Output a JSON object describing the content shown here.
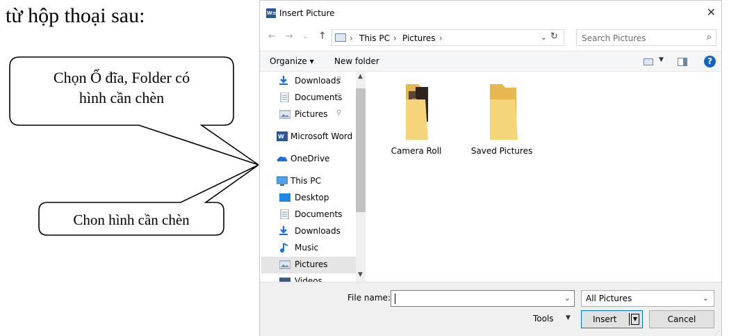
{
  "document": {
    "heading": "từ hộp thoại sau:",
    "callouts": [
      {
        "line1": "Chọn Ổ đĩa, Folder có",
        "line2": "hình cần chèn"
      },
      {
        "line1": "Chon hình cần chèn"
      }
    ]
  },
  "dialog": {
    "title": "Insert Picture",
    "close_glyph": "✕",
    "nav": {
      "back": "←",
      "forward": "→",
      "recent": "⌄",
      "up": "↑",
      "breadcrumb": [
        "This PC",
        "Pictures"
      ],
      "separator": "›",
      "refresh": "↻",
      "search_placeholder": "Search Pictures"
    },
    "toolbar": {
      "organize": "Organize ▾",
      "new_folder": "New folder",
      "help": "?"
    },
    "sidebar": [
      {
        "label": "Downloads",
        "pinned": true,
        "icon": "download-icon"
      },
      {
        "label": "Documents",
        "pinned": true,
        "icon": "document-icon"
      },
      {
        "label": "Pictures",
        "pinned": true,
        "icon": "pictures-icon"
      },
      {
        "label": "Microsoft Word",
        "pinned": false,
        "icon": "word-icon"
      },
      {
        "label": "OneDrive",
        "pinned": false,
        "icon": "onedrive-icon"
      },
      {
        "label": "This PC",
        "pinned": false,
        "icon": "pc-icon"
      },
      {
        "label": "Desktop",
        "pinned": false,
        "icon": "desktop-icon"
      },
      {
        "label": "Documents",
        "pinned": false,
        "icon": "document-icon"
      },
      {
        "label": "Downloads",
        "pinned": false,
        "icon": "download-icon"
      },
      {
        "label": "Music",
        "pinned": false,
        "icon": "music-icon"
      },
      {
        "label": "Pictures",
        "pinned": false,
        "selected": true,
        "icon": "pictures-icon"
      },
      {
        "label": "Videos",
        "pinned": false,
        "icon": "video-icon"
      }
    ],
    "pin_glyph": "✈",
    "folders": [
      {
        "label": "Camera Roll",
        "has_photos": true
      },
      {
        "label": "Saved Pictures",
        "has_photos": false
      }
    ],
    "footer": {
      "file_name_label": "File name:",
      "file_name_value": "",
      "filter_value": "All Pictures",
      "tools_label": "Tools",
      "insert_label": "Insert",
      "cancel_label": "Cancel"
    }
  },
  "colors": {
    "accent": "#0078d7",
    "selection": "#e5e5e5",
    "folder": "#f6d47a",
    "help": "#1565c0"
  }
}
